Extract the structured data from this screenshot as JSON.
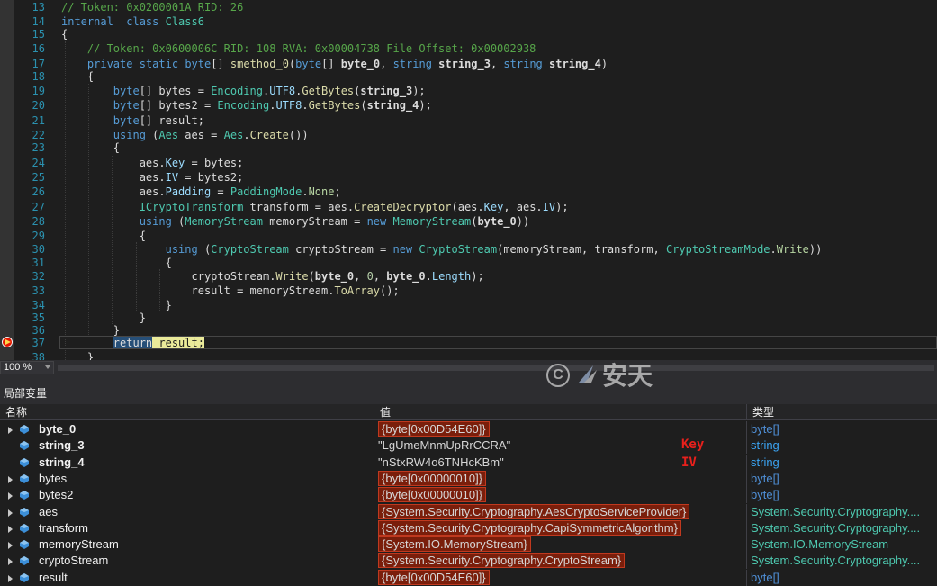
{
  "editor": {
    "lines": [
      {
        "num": "13",
        "tokens": [
          [
            "cm",
            "// Token: 0x0200001A RID: 26"
          ]
        ]
      },
      {
        "num": "14",
        "tokens": [
          [
            "kw",
            "internal"
          ],
          [
            "",
            "  "
          ],
          [
            "kw",
            "class"
          ],
          [
            "",
            " "
          ],
          [
            "ty",
            "Class6"
          ]
        ]
      },
      {
        "num": "15",
        "tokens": [
          [
            "",
            "{"
          ]
        ]
      },
      {
        "num": "16",
        "tokens": [
          [
            "",
            "    "
          ],
          [
            "cm",
            "// Token: 0x0600006C RID: 108 RVA: 0x00004738 File Offset: 0x00002938"
          ]
        ]
      },
      {
        "num": "17",
        "tokens": [
          [
            "",
            "    "
          ],
          [
            "kw",
            "private"
          ],
          [
            "",
            " "
          ],
          [
            "kw",
            "static"
          ],
          [
            "",
            " "
          ],
          [
            "kw",
            "byte"
          ],
          [
            "",
            "[] "
          ],
          [
            "mt",
            "smethod_0"
          ],
          [
            "",
            "("
          ],
          [
            "kw",
            "byte"
          ],
          [
            "",
            "[] "
          ],
          [
            "prm",
            "byte_0"
          ],
          [
            "",
            ", "
          ],
          [
            "kw",
            "string"
          ],
          [
            "",
            " "
          ],
          [
            "prm",
            "string_3"
          ],
          [
            "",
            ", "
          ],
          [
            "kw",
            "string"
          ],
          [
            "",
            " "
          ],
          [
            "prm",
            "string_4"
          ],
          [
            "",
            ")"
          ]
        ]
      },
      {
        "num": "18",
        "tokens": [
          [
            "",
            "    {"
          ]
        ]
      },
      {
        "num": "19",
        "tokens": [
          [
            "",
            "        "
          ],
          [
            "kw",
            "byte"
          ],
          [
            "",
            "[] bytes = "
          ],
          [
            "ty",
            "Encoding"
          ],
          [
            "",
            "."
          ],
          [
            "pr",
            "UTF8"
          ],
          [
            "",
            "."
          ],
          [
            "mt",
            "GetBytes"
          ],
          [
            "",
            "("
          ],
          [
            "prm",
            "string_3"
          ],
          [
            "",
            ");"
          ]
        ]
      },
      {
        "num": "20",
        "tokens": [
          [
            "",
            "        "
          ],
          [
            "kw",
            "byte"
          ],
          [
            "",
            "[] bytes2 = "
          ],
          [
            "ty",
            "Encoding"
          ],
          [
            "",
            "."
          ],
          [
            "pr",
            "UTF8"
          ],
          [
            "",
            "."
          ],
          [
            "mt",
            "GetBytes"
          ],
          [
            "",
            "("
          ],
          [
            "prm",
            "string_4"
          ],
          [
            "",
            ");"
          ]
        ]
      },
      {
        "num": "21",
        "tokens": [
          [
            "",
            "        "
          ],
          [
            "kw",
            "byte"
          ],
          [
            "",
            "[] result;"
          ]
        ]
      },
      {
        "num": "22",
        "tokens": [
          [
            "",
            "        "
          ],
          [
            "kw",
            "using"
          ],
          [
            "",
            " ("
          ],
          [
            "ty",
            "Aes"
          ],
          [
            "",
            " aes = "
          ],
          [
            "ty",
            "Aes"
          ],
          [
            "",
            "."
          ],
          [
            "mt",
            "Create"
          ],
          [
            "",
            "())"
          ]
        ]
      },
      {
        "num": "23",
        "tokens": [
          [
            "",
            "        {"
          ]
        ]
      },
      {
        "num": "24",
        "tokens": [
          [
            "",
            "            aes."
          ],
          [
            "pr",
            "Key"
          ],
          [
            "",
            " = bytes;"
          ]
        ]
      },
      {
        "num": "25",
        "tokens": [
          [
            "",
            "            aes."
          ],
          [
            "pr",
            "IV"
          ],
          [
            "",
            " = bytes2;"
          ]
        ]
      },
      {
        "num": "26",
        "tokens": [
          [
            "",
            "            aes."
          ],
          [
            "pr",
            "Padding"
          ],
          [
            "",
            " = "
          ],
          [
            "ty",
            "PaddingMode"
          ],
          [
            "",
            "."
          ],
          [
            "en",
            "None"
          ],
          [
            "",
            ";"
          ]
        ]
      },
      {
        "num": "27",
        "tokens": [
          [
            "",
            "            "
          ],
          [
            "ty",
            "ICryptoTransform"
          ],
          [
            "",
            " transform = aes."
          ],
          [
            "mt",
            "CreateDecryptor"
          ],
          [
            "",
            "(aes."
          ],
          [
            "pr",
            "Key"
          ],
          [
            "",
            ", aes."
          ],
          [
            "pr",
            "IV"
          ],
          [
            "",
            ");"
          ]
        ]
      },
      {
        "num": "28",
        "tokens": [
          [
            "",
            "            "
          ],
          [
            "kw",
            "using"
          ],
          [
            "",
            " ("
          ],
          [
            "ty",
            "MemoryStream"
          ],
          [
            "",
            " memoryStream = "
          ],
          [
            "kw",
            "new"
          ],
          [
            "",
            " "
          ],
          [
            "ty",
            "MemoryStream"
          ],
          [
            "",
            "("
          ],
          [
            "prm",
            "byte_0"
          ],
          [
            "",
            "))"
          ]
        ]
      },
      {
        "num": "29",
        "tokens": [
          [
            "",
            "            {"
          ]
        ]
      },
      {
        "num": "30",
        "tokens": [
          [
            "",
            "                "
          ],
          [
            "kw",
            "using"
          ],
          [
            "",
            " ("
          ],
          [
            "ty",
            "CryptoStream"
          ],
          [
            "",
            " cryptoStream = "
          ],
          [
            "kw",
            "new"
          ],
          [
            "",
            " "
          ],
          [
            "ty",
            "CryptoStream"
          ],
          [
            "",
            "(memoryStream, transform, "
          ],
          [
            "ty",
            "CryptoStreamMode"
          ],
          [
            "",
            "."
          ],
          [
            "en",
            "Write"
          ],
          [
            "",
            "))"
          ]
        ]
      },
      {
        "num": "31",
        "tokens": [
          [
            "",
            "                {"
          ]
        ]
      },
      {
        "num": "32",
        "tokens": [
          [
            "",
            "                    cryptoStream."
          ],
          [
            "mt",
            "Write"
          ],
          [
            "",
            "("
          ],
          [
            "prm",
            "byte_0"
          ],
          [
            "",
            ", "
          ],
          [
            "nm",
            "0"
          ],
          [
            "",
            ", "
          ],
          [
            "prm",
            "byte_0"
          ],
          [
            "",
            "."
          ],
          [
            "pr",
            "Length"
          ],
          [
            "",
            ");"
          ]
        ]
      },
      {
        "num": "33",
        "tokens": [
          [
            "",
            "                    result = memoryStream."
          ],
          [
            "mt",
            "ToArray"
          ],
          [
            "",
            "();"
          ]
        ]
      },
      {
        "num": "34",
        "tokens": [
          [
            "",
            "                }"
          ]
        ]
      },
      {
        "num": "35",
        "tokens": [
          [
            "",
            "            }"
          ]
        ]
      },
      {
        "num": "36",
        "tokens": [
          [
            "",
            "        }"
          ]
        ]
      },
      {
        "num": "37",
        "tokens": [
          [
            "",
            "        "
          ],
          [
            "hl-sel",
            "return"
          ],
          [
            "hl-stmt",
            " result;"
          ]
        ]
      },
      {
        "num": "38",
        "tokens": [
          [
            "",
            "    }"
          ]
        ]
      }
    ]
  },
  "zoom": {
    "label": "100 %"
  },
  "panel": {
    "title": "局部变量"
  },
  "watermark": {
    "text": "安天"
  },
  "grid": {
    "headers": {
      "name": "名称",
      "value": "值",
      "type": "类型"
    },
    "rows": [
      {
        "name": "byte_0",
        "bold": true,
        "expand": true,
        "value": "{byte[0x00D54E60]}",
        "value_style": "box",
        "type": "byte[]",
        "type_style": "blue"
      },
      {
        "name": "string_3",
        "bold": true,
        "expand": false,
        "value": "\"LgUmeMnmUpRrCCRA\"",
        "value_style": "plain",
        "type": "string",
        "type_style": "str"
      },
      {
        "name": "string_4",
        "bold": true,
        "expand": false,
        "value": "\"nStxRW4o6TNHcKBm\"",
        "value_style": "plain",
        "type": "string",
        "type_style": "str"
      },
      {
        "name": "bytes",
        "bold": false,
        "expand": true,
        "value": "{byte[0x00000010]}",
        "value_style": "box",
        "type": "byte[]",
        "type_style": "blue"
      },
      {
        "name": "bytes2",
        "bold": false,
        "expand": true,
        "value": "{byte[0x00000010]}",
        "value_style": "box",
        "type": "byte[]",
        "type_style": "blue"
      },
      {
        "name": "aes",
        "bold": false,
        "expand": true,
        "value": "{System.Security.Cryptography.AesCryptoServiceProvider}",
        "value_style": "box",
        "type": "System.Security.Cryptography....",
        "type_style": "teal"
      },
      {
        "name": "transform",
        "bold": false,
        "expand": true,
        "value": "{System.Security.Cryptography.CapiSymmetricAlgorithm}",
        "value_style": "box",
        "type": "System.Security.Cryptography....",
        "type_style": "teal"
      },
      {
        "name": "memoryStream",
        "bold": false,
        "expand": true,
        "value": "{System.IO.MemoryStream}",
        "value_style": "box",
        "type": "System.IO.MemoryStream",
        "type_style": "teal"
      },
      {
        "name": "cryptoStream",
        "bold": false,
        "expand": true,
        "value": "{System.Security.Cryptography.CryptoStream}",
        "value_style": "box",
        "type": "System.Security.Cryptography....",
        "type_style": "teal"
      },
      {
        "name": "result",
        "bold": false,
        "expand": true,
        "value": "{byte[0x00D54E60]}",
        "value_style": "box",
        "type": "byte[]",
        "type_style": "blue"
      }
    ]
  },
  "annotations": {
    "key": "Key",
    "iv": "IV"
  },
  "colors": {
    "editor_bg": "#1e1e1e",
    "keyword": "#569cd6",
    "type": "#4ec9b0",
    "comment": "#57a64a",
    "highlight_box": "#7a1e0b",
    "annotation": "#e8201c"
  }
}
